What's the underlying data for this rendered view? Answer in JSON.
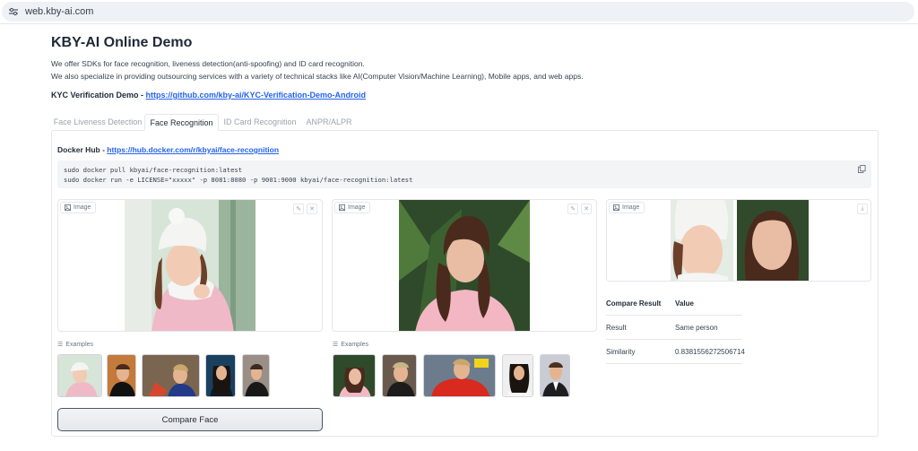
{
  "browser": {
    "url": "web.kby-ai.com",
    "site_icon": "tune-icon"
  },
  "header": {
    "title": "KBY-AI Online Demo",
    "desc1": "We offer SDKs for face recognition, liveness detection(anti-spoofing) and ID card recognition.",
    "desc2": "We also specialize in providing outsourcing services with a variety of technical stacks like AI(Computer Vision/Machine Learning), Mobile apps, and web apps.",
    "kyc_label": "KYC Verification Demo - ",
    "kyc_link": "https://github.com/kby-ai/KYC-Verification-Demo-Android"
  },
  "tabs": [
    {
      "label": "Face Liveness Detection",
      "active": false
    },
    {
      "label": "Face Recognition",
      "active": true
    },
    {
      "label": "ID Card Recognition",
      "active": false
    },
    {
      "label": "ANPR/ALPR",
      "active": false
    }
  ],
  "docker": {
    "label": "Docker Hub - ",
    "link": "https://hub.docker.com/r/kbyai/face-recognition",
    "code": "sudo docker pull kbyai/face-recognition:latest\nsudo docker run -e LICENSE=\"xxxxx\" -p 8081:8080 -p 9001:9000 kbyai/face-recognition:latest"
  },
  "image_panels": {
    "label": "Image",
    "edit_icon": "pencil-icon",
    "clear_icon": "close-icon",
    "download_icon": "download-icon"
  },
  "examples_label": "Examples",
  "compare_button": "Compare Face",
  "result": {
    "col1": "Compare Result",
    "col2": "Value",
    "rows": [
      {
        "key": "Result",
        "value": "Same person"
      },
      {
        "key": "Similarity",
        "value": "0.8381556272506714"
      }
    ]
  },
  "colors": {
    "link": "#2563eb",
    "border": "#e5e7eb",
    "code_bg": "#f3f4f6"
  }
}
